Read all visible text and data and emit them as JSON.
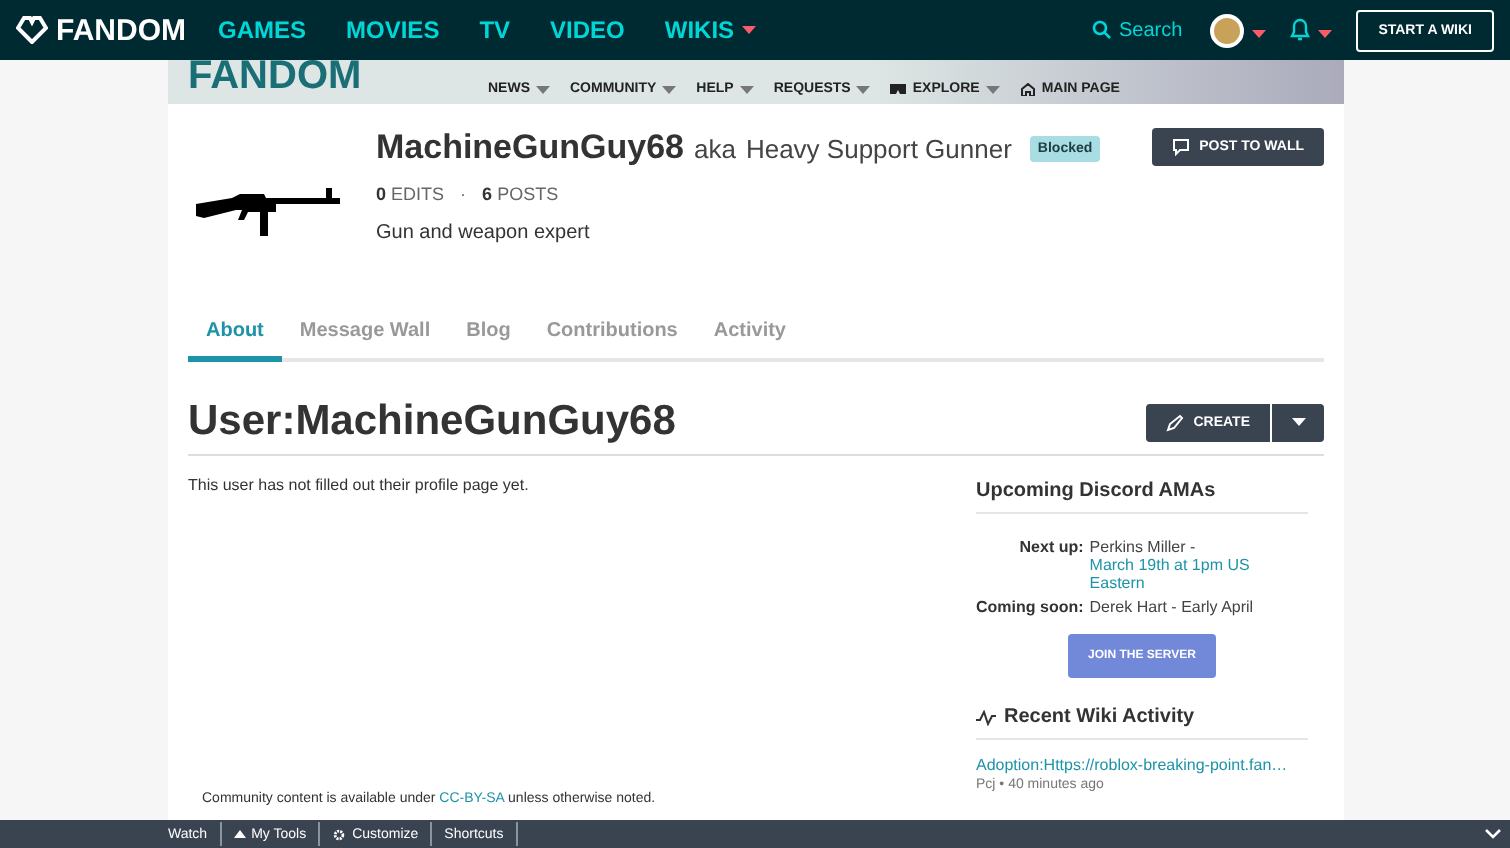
{
  "top_nav": {
    "logo": "FANDOM",
    "links": [
      {
        "label": "GAMES",
        "dropdown": false
      },
      {
        "label": "MOVIES",
        "dropdown": false
      },
      {
        "label": "TV",
        "dropdown": false
      },
      {
        "label": "VIDEO",
        "dropdown": false
      },
      {
        "label": "WIKIS",
        "dropdown": true
      }
    ],
    "search": "Search",
    "start_button": "START A WIKI"
  },
  "wiki_header": {
    "logo": "FANDOM",
    "nav": [
      {
        "label": "NEWS",
        "kind": "plain",
        "dropdown": true
      },
      {
        "label": "COMMUNITY",
        "kind": "plain",
        "dropdown": true
      },
      {
        "label": "HELP",
        "kind": "plain",
        "dropdown": true
      },
      {
        "label": "REQUESTS",
        "kind": "plain",
        "dropdown": true
      },
      {
        "label": "EXPLORE",
        "kind": "explore",
        "dropdown": true
      },
      {
        "label": "MAIN PAGE",
        "kind": "home",
        "dropdown": false
      }
    ]
  },
  "profile": {
    "username": "MachineGunGuy68",
    "aka": "aka",
    "nickname": "Heavy Support Gunner",
    "badge": "Blocked",
    "edits_count": "0",
    "edits_label": "EDITS",
    "separator": "·",
    "posts_count": "6",
    "posts_label": "POSTS",
    "bio": "Gun and weapon expert",
    "post_button": "POST TO WALL"
  },
  "tabs": [
    {
      "label": "About",
      "selected": true
    },
    {
      "label": "Message Wall",
      "selected": false
    },
    {
      "label": "Blog",
      "selected": false
    },
    {
      "label": "Contributions",
      "selected": false
    },
    {
      "label": "Activity",
      "selected": false
    }
  ],
  "page_title": "User:MachineGunGuy68",
  "create_button": "CREATE",
  "body_text": "This user has not filled out their profile page yet.",
  "rail": {
    "ama_title": "Upcoming Discord AMAs",
    "ama_rows": [
      {
        "label": "Next up:",
        "text": "Perkins Miller - ",
        "link": "March 19th at 1pm US Eastern"
      },
      {
        "label": "Coming soon:",
        "text": "Derek Hart - Early April"
      }
    ],
    "join_button": "JOIN THE SERVER",
    "activity_title": "Recent Wiki Activity",
    "activity": [
      {
        "title": "Adoption:Https://roblox-breaking-point.fan…",
        "meta": "Pcj • 40 minutes ago"
      }
    ]
  },
  "footer": {
    "before": "Community content is available under ",
    "link": "CC-BY-SA",
    "after": " unless otherwise noted."
  },
  "toolbar": [
    {
      "label": "Watch",
      "kind": "plain"
    },
    {
      "label": "My Tools",
      "kind": "menu"
    },
    {
      "label": "Customize",
      "kind": "settings"
    },
    {
      "label": "Shortcuts",
      "kind": "plain"
    }
  ]
}
